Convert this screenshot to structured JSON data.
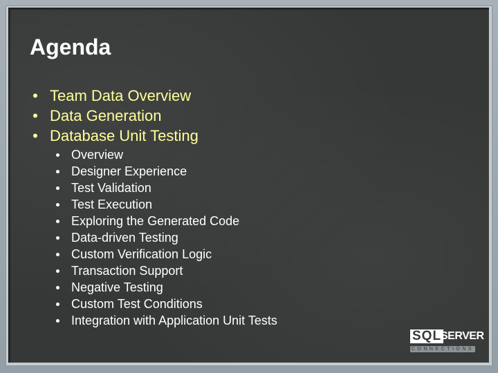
{
  "slide": {
    "title": "Agenda",
    "bullets": [
      {
        "bullet": "•",
        "text": "Team Data Overview"
      },
      {
        "bullet": "•",
        "text": "Data Generation"
      },
      {
        "bullet": "•",
        "text": "Database Unit Testing"
      }
    ],
    "sub_bullets": [
      "Overview",
      "Designer Experience",
      "Test Validation",
      "Test Execution",
      "Exploring the Generated Code",
      "Data-driven Testing",
      "Custom Verification Logic",
      "Transaction Support",
      "Negative Testing",
      "Custom Test Conditions",
      "Integration with Application Unit Tests"
    ],
    "colors": {
      "board": "#363838",
      "frame": "#a3adb3",
      "title": "#ffffff",
      "level1_text": "#ffff99",
      "level2_text": "#ffffff"
    }
  },
  "logo": {
    "sql": "SQL",
    "server": "SERVER",
    "subtitle": "CONNECTIONS"
  }
}
